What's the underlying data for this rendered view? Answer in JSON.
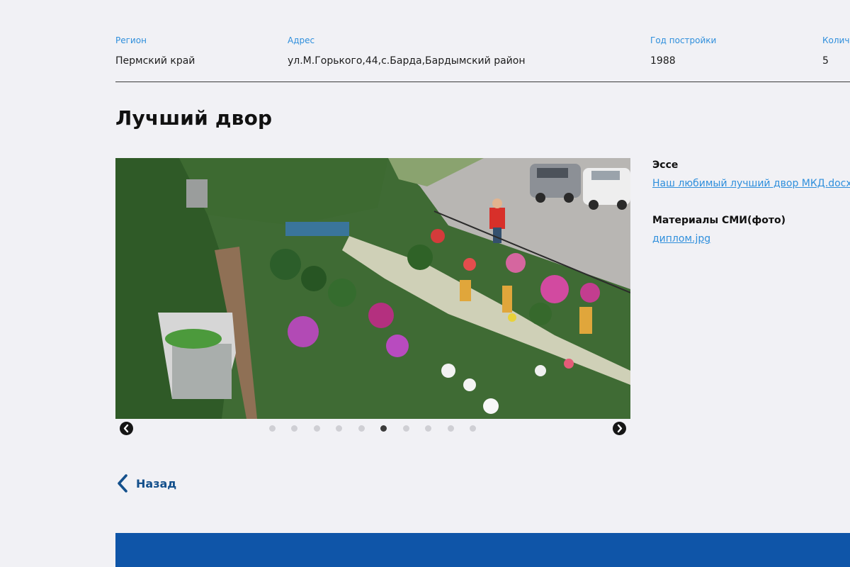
{
  "info": {
    "region": {
      "label": "Регион",
      "value": "Пермский край"
    },
    "address": {
      "label": "Адрес",
      "value": "ул.М.Горького,44,с.Барда,Бардымский район"
    },
    "year": {
      "label": "Год постройки",
      "value": "1988"
    },
    "count": {
      "label": "Количество",
      "value": "5"
    }
  },
  "page": {
    "title": "Лучший двор"
  },
  "side": {
    "essay": {
      "label": "Эссе",
      "link": "Наш любимый лучший двор МКД.docx"
    },
    "media": {
      "label": "Материалы СМИ(фото)",
      "link": "диплом.jpg"
    }
  },
  "carousel": {
    "slide_count": 10,
    "active_slide": 6,
    "prev_icon": "chevron-left-circle-icon",
    "next_icon": "chevron-right-circle-icon"
  },
  "back": {
    "label": "Назад",
    "icon": "chevron-left-icon"
  },
  "colors": {
    "background": "#f1f1f5",
    "accent": "#2f8fdc",
    "brand": "#0f55a8",
    "back_link": "#14508c"
  }
}
